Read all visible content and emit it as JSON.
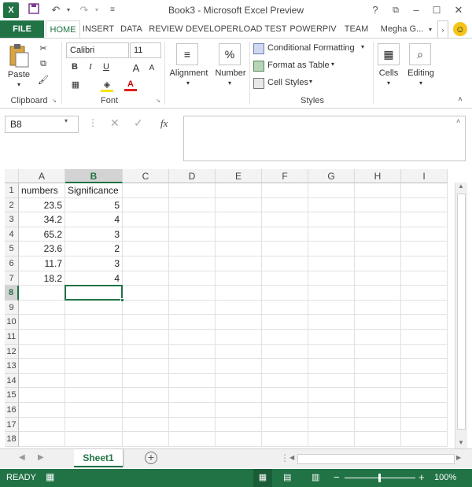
{
  "window": {
    "title": "Book3 - Microsoft Excel Preview",
    "help_label": "?",
    "user": "Megha G...",
    "accent_color": "#217346"
  },
  "tabs": [
    "FILE",
    "HOME",
    "INSERT",
    "DATA",
    "REVIEW",
    "DEVELOPER",
    "LOAD TEST",
    "POWERPIV",
    "TEAM"
  ],
  "ribbon": {
    "clipboard": {
      "paste_label": "Paste",
      "group_label": "Clipboard"
    },
    "font": {
      "font_name": "Calibri",
      "font_size": "11",
      "bold": "B",
      "italic": "I",
      "underline": "U",
      "grow": "A",
      "shrink": "A",
      "font_color": "A",
      "group_label": "Font"
    },
    "alignment_label": "Alignment",
    "number_label": "Number",
    "number_icon": "%",
    "styles": {
      "conditional_formatting": "Conditional Formatting",
      "format_as_table": "Format as Table",
      "cell_styles": "Cell Styles",
      "group_label": "Styles"
    },
    "cells_label": "Cells",
    "editing_label": "Editing"
  },
  "formula_bar": {
    "name_box": "B8",
    "fx_label": "fx",
    "formula_value": ""
  },
  "grid": {
    "columns": [
      "A",
      "B",
      "C",
      "D",
      "E",
      "F",
      "G",
      "H",
      "I"
    ],
    "selected_column": "B",
    "rows": [
      "1",
      "2",
      "3",
      "4",
      "5",
      "6",
      "7",
      "8",
      "9",
      "10",
      "11",
      "12",
      "13",
      "14",
      "15",
      "16",
      "17",
      "18"
    ],
    "selected_row": "8",
    "cells": [
      [
        "numbers",
        "Significance"
      ],
      [
        "23.5",
        "5"
      ],
      [
        "34.2",
        "4"
      ],
      [
        "65.2",
        "3"
      ],
      [
        "23.6",
        "2"
      ],
      [
        "11.7",
        "3"
      ],
      [
        "18.2",
        "4"
      ]
    ]
  },
  "sheets": {
    "active": "Sheet1",
    "add_label": "+"
  },
  "status": {
    "mode": "READY",
    "zoom": "100%"
  }
}
